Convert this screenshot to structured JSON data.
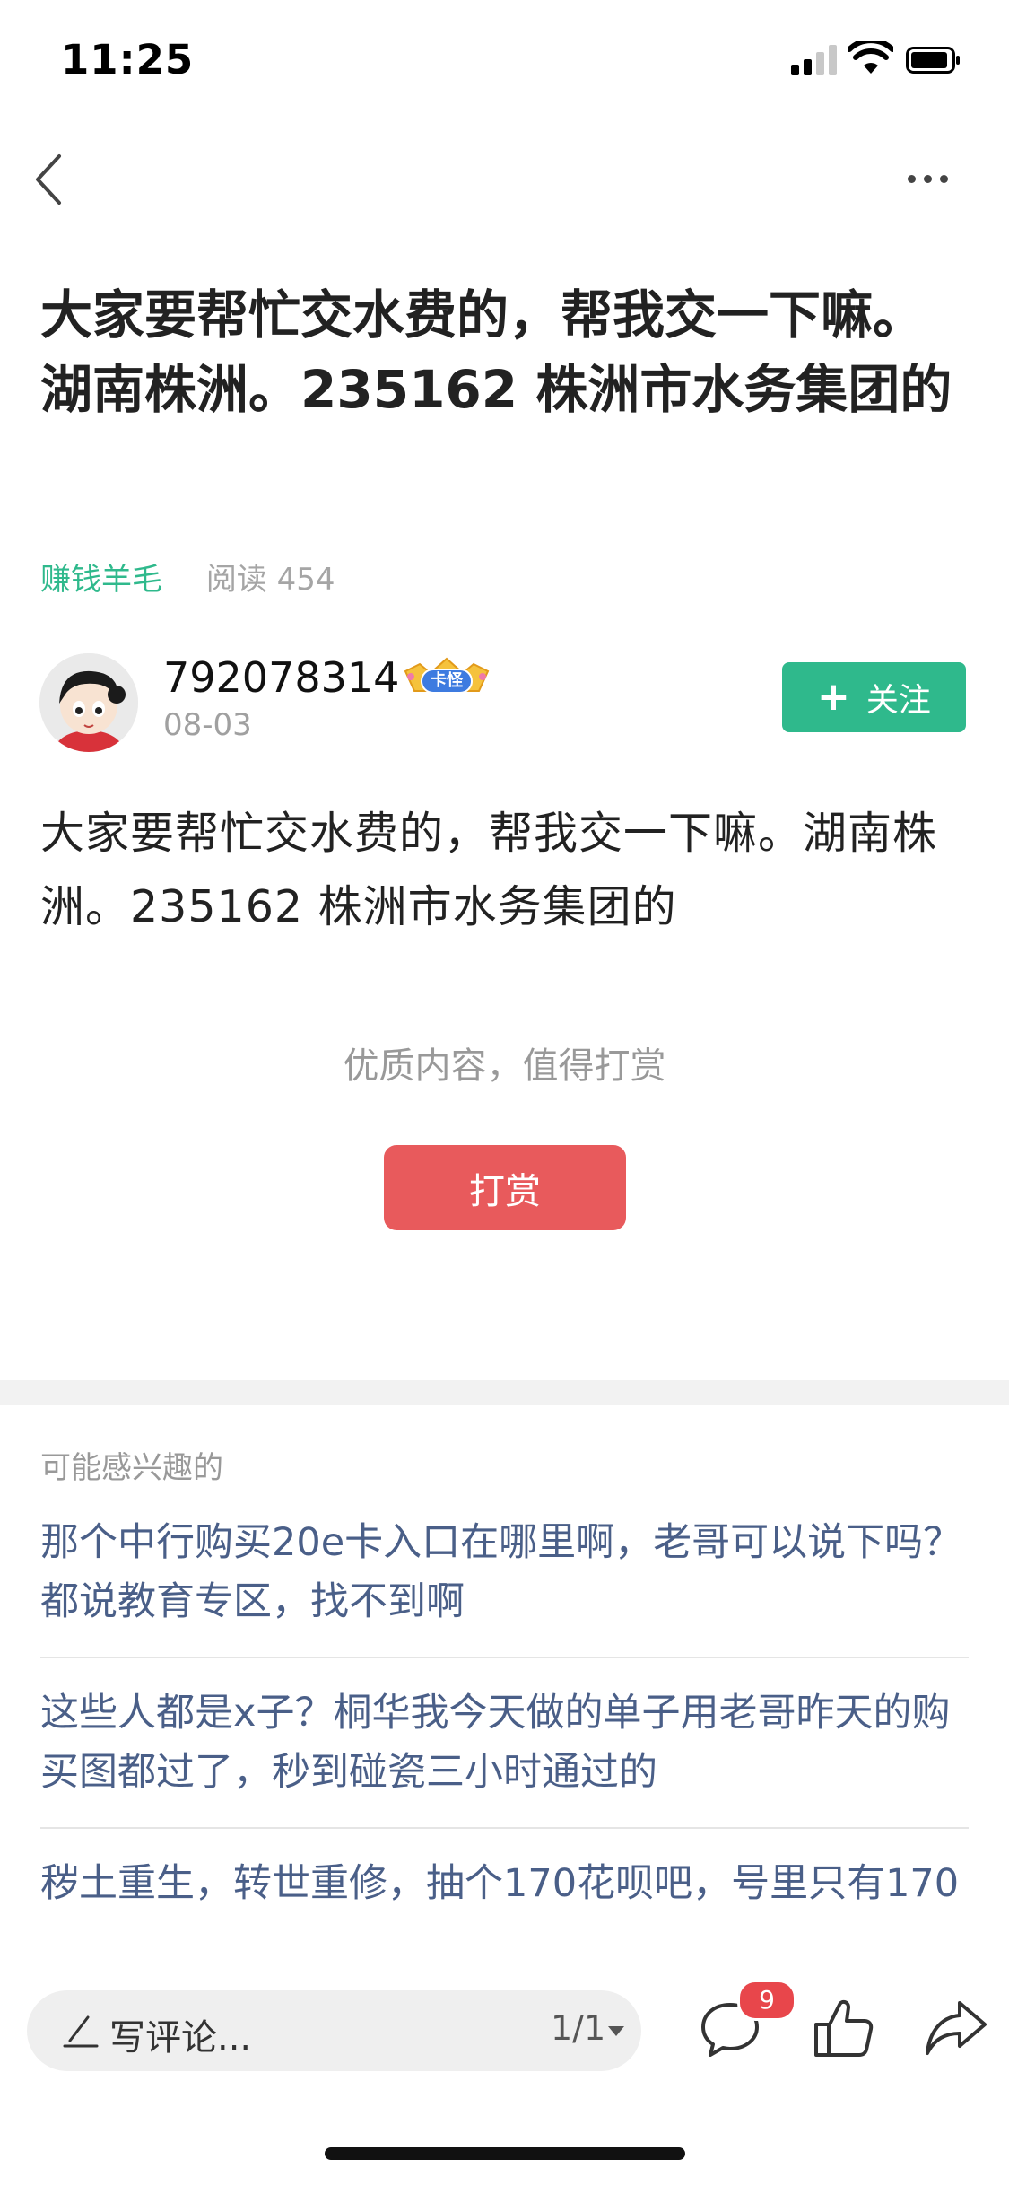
{
  "status_bar": {
    "time": "11:25"
  },
  "nav": {
    "back_icon": "chevron-left-icon",
    "more_icon": "more-horizontal-icon"
  },
  "article": {
    "title": "大家要帮忙交水费的，帮我交一下嘛。湖南株洲。235162 株洲市水务集团的",
    "category": "赚钱羊毛",
    "read_count": "阅读 454",
    "body": "大家要帮忙交水费的，帮我交一下嘛。湖南株洲。235162   株洲市水务集团的"
  },
  "author": {
    "name": "792078314",
    "badge": "卡怪",
    "date": "08-03",
    "follow_label": "关注"
  },
  "reward": {
    "hint": "优质内容，值得打赏",
    "button_label": "打赏"
  },
  "related": {
    "heading": "可能感兴趣的",
    "items": [
      "那个中行购买20e卡入口在哪里啊，老哥可以说下吗？都说教育专区，找不到啊",
      "这些人都是x子？桐华我今天做的单子用老哥昨天的购买图都过了，秒到碰瓷三小时通过的",
      "秽土重生，转世重修，抽个170花呗吧，号里只有170"
    ]
  },
  "toolbar": {
    "comment_placeholder": "写评论...",
    "page_indicator": "1/1",
    "comment_count": "9"
  },
  "colors": {
    "accent_green": "#2fb98c",
    "reward_red": "#e85a5c",
    "link_blue": "#4a5f88",
    "badge_red": "#e8464b"
  }
}
